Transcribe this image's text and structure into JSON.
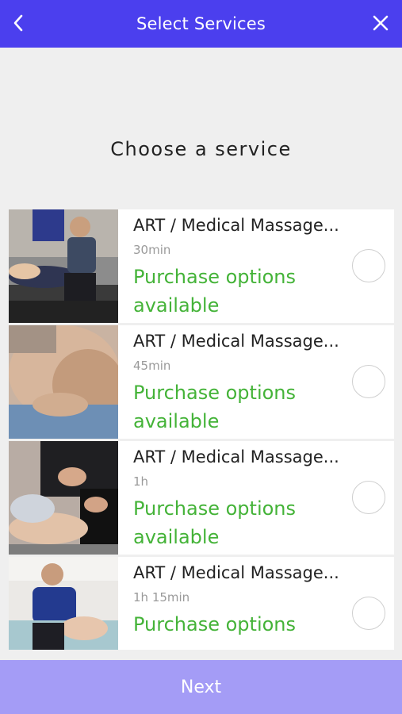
{
  "header": {
    "title": "Select Services",
    "back_icon": "chevron-left-icon",
    "close_icon": "close-icon"
  },
  "subtitle": "Choose a service",
  "services": [
    {
      "name": "ART / Medical Massage...",
      "duration": "30min",
      "status": "Purchase options available"
    },
    {
      "name": "ART / Medical Massage...",
      "duration": "45min",
      "status": "Purchase options available"
    },
    {
      "name": "ART / Medical Massage...",
      "duration": "1h",
      "status": "Purchase options available"
    },
    {
      "name": "ART / Medical Massage...",
      "duration": "1h 15min",
      "status": "Purchase options"
    }
  ],
  "footer": {
    "next_label": "Next"
  },
  "colors": {
    "header_bg": "#4b3fee",
    "footer_bg": "#a49cf6",
    "accent_green": "#44b338"
  }
}
